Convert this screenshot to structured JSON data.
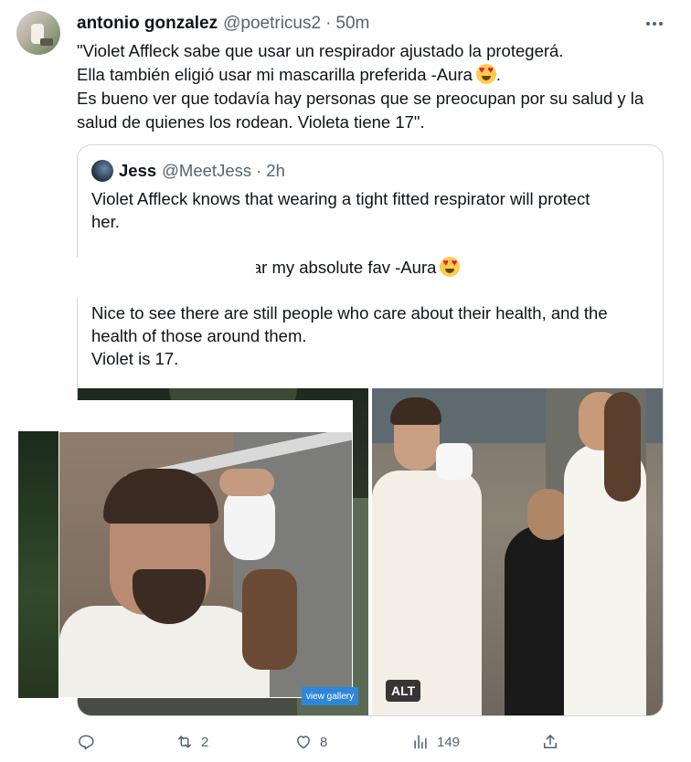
{
  "author": {
    "display_name": "antonio gonzalez",
    "handle": "@poetricus2",
    "separator": "·",
    "time": "50m"
  },
  "tweet": {
    "lines": [
      "\"Violet Affleck sabe que usar un respirador ajustado la protegerá.",
      "Ella también eligió usar mi mascarilla preferida -Aura",
      ".",
      "Es bueno ver que todavía hay personas que se preocupan por su salud y la",
      "salud de quienes los rodean. Violeta tiene 17\"."
    ]
  },
  "quoted": {
    "display_name": "Jess",
    "handle": "@MeetJess",
    "separator": "·",
    "time": "2h",
    "paragraphs": [
      [
        "Violet Affleck knows that wearing a tight fitted respirator will protect",
        "her."
      ],
      [
        "She also chose to wear my absolute fav -Aura"
      ],
      [
        "Nice to see there are still people who care about their health, and the",
        "health of those around them.",
        "Violet is 17."
      ]
    ],
    "media": {
      "alt_badge": "ALT",
      "inset_button": "view gallery"
    }
  },
  "actions": {
    "reply_count": "",
    "retweet_count": "2",
    "like_count": "8",
    "views_count": "149",
    "share_count": ""
  },
  "colors": {
    "text": "#0f1419",
    "secondary": "#536471",
    "border": "#cfd9de",
    "gallery_blue": "#2f86d9"
  },
  "icons": [
    "more-icon",
    "heart-eyes-emoji",
    "reply-icon",
    "retweet-icon",
    "like-icon",
    "views-icon",
    "share-icon"
  ]
}
